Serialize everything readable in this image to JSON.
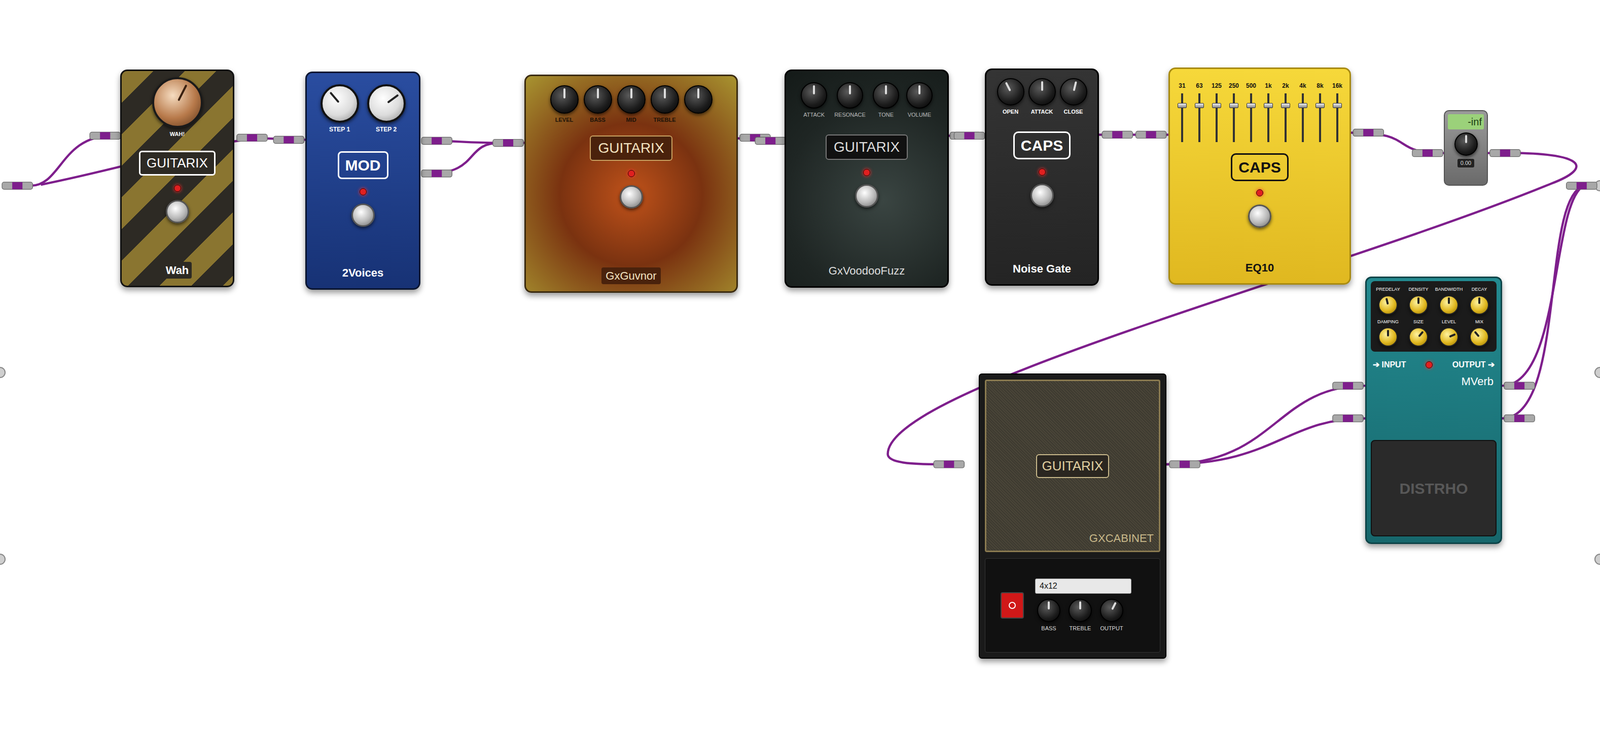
{
  "pedals": [
    {
      "name": "Wah",
      "brand": "GUITARIX",
      "on": true,
      "color": "#8a7530",
      "knobs": [
        {
          "label": "WAH!",
          "level": 0.6
        }
      ]
    },
    {
      "name": "2Voices",
      "brand": "MOD",
      "on": true,
      "color": "#1f3d8a",
      "knobs": [
        {
          "label": "STEP 1",
          "level": 0.35
        },
        {
          "label": "STEP 2",
          "level": 0.7
        }
      ]
    },
    {
      "name": "GxGuvnor",
      "brand": "GUITARIX",
      "on": true,
      "color": "#b0501a",
      "knobs": [
        {
          "label": "LEVEL",
          "level": 0.5
        },
        {
          "label": "BASS",
          "level": 0.5
        },
        {
          "label": "MID",
          "level": 0.5
        },
        {
          "label": "TREBLE",
          "level": 0.5
        },
        {
          "level": 0.5
        }
      ]
    },
    {
      "name": "GxVoodooFuzz",
      "brand": "GUITARIX",
      "on": true,
      "color": "#1f2624",
      "knobs": [
        {
          "label": "ATTACK",
          "level": 0.5
        },
        {
          "label": "RESONACE",
          "level": 0.5
        },
        {
          "label": "TONE",
          "level": 0.5
        },
        {
          "label": "VOLUME",
          "level": 0.5
        }
      ]
    },
    {
      "name": "Noise Gate",
      "brand": "CAPS",
      "on": true,
      "color": "#2c2c2c",
      "knobs": [
        {
          "label": "OPEN",
          "level": 0.4
        },
        {
          "label": "ATTACK",
          "level": 0.5
        },
        {
          "label": "CLOSE",
          "level": 0.55
        }
      ]
    }
  ],
  "eq10": {
    "name": "EQ10",
    "brand": "CAPS",
    "on": true,
    "bands": [
      {
        "label": "31",
        "level": 0.75
      },
      {
        "label": "63",
        "level": 0.75
      },
      {
        "label": "125",
        "level": 0.75
      },
      {
        "label": "250",
        "level": 0.75
      },
      {
        "label": "500",
        "level": 0.75
      },
      {
        "label": "1k",
        "level": 0.75
      },
      {
        "label": "2k",
        "level": 0.75
      },
      {
        "label": "4k",
        "level": 0.75
      },
      {
        "label": "8k",
        "level": 0.75
      },
      {
        "label": "16k",
        "level": 0.75
      }
    ]
  },
  "gain": {
    "display": "-inf",
    "reading": "0.00",
    "level": 0.5
  },
  "mverb": {
    "name": "MVerb",
    "brand": "DISTRHO",
    "on": true,
    "input": "➔ INPUT",
    "output": "OUTPUT ➔",
    "knobs": [
      {
        "label": "PREDELAY",
        "level": 0.45
      },
      {
        "label": "DENSITY",
        "level": 0.5
      },
      {
        "label": "BANDWIDTH",
        "level": 0.5
      },
      {
        "label": "DECAY",
        "level": 0.5
      },
      {
        "label": "DAMPING",
        "level": 0.5
      },
      {
        "label": "SIZE",
        "level": 0.65
      },
      {
        "label": "LEVEL",
        "level": 0.75
      },
      {
        "label": "MIX",
        "level": 0.35
      }
    ]
  },
  "cabinet": {
    "brand": "GUITARIX",
    "name": "GXCABINET",
    "model": "4x12",
    "on": true,
    "knobs": [
      {
        "label": "BASS",
        "level": 0.5
      },
      {
        "label": "TREBLE",
        "level": 0.5
      },
      {
        "label": "OUTPUT",
        "level": 0.6
      }
    ]
  }
}
